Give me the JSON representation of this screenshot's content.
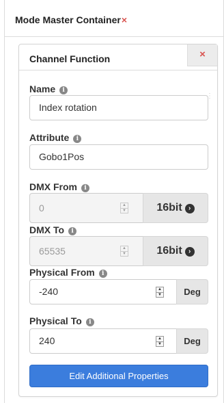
{
  "container": {
    "title": "Mode Master Container",
    "close_icon": "×"
  },
  "panel": {
    "title": "Channel Function",
    "close_icon": "×",
    "fields": {
      "name": {
        "label": "Name",
        "value": "Index rotation"
      },
      "attribute": {
        "label": "Attribute",
        "value": "Gobo1Pos"
      },
      "dmx_from": {
        "label": "DMX From",
        "value": "0",
        "bits": "16bit"
      },
      "dmx_to": {
        "label": "DMX To",
        "value": "65535",
        "bits": "16bit"
      },
      "physical_from": {
        "label": "Physical From",
        "value": "-240",
        "unit": "Deg"
      },
      "physical_to": {
        "label": "Physical To",
        "value": "240",
        "unit": "Deg"
      }
    },
    "button": {
      "label": "Edit Additional Properties"
    },
    "info_icon": "i"
  },
  "colors": {
    "close": "#d9534f",
    "primary_button": "#3b7ddd",
    "addon": "#e6e6e6"
  },
  "icons": [
    "close-icon",
    "info-icon",
    "chevron-right-circle-icon",
    "spinner-icon"
  ]
}
